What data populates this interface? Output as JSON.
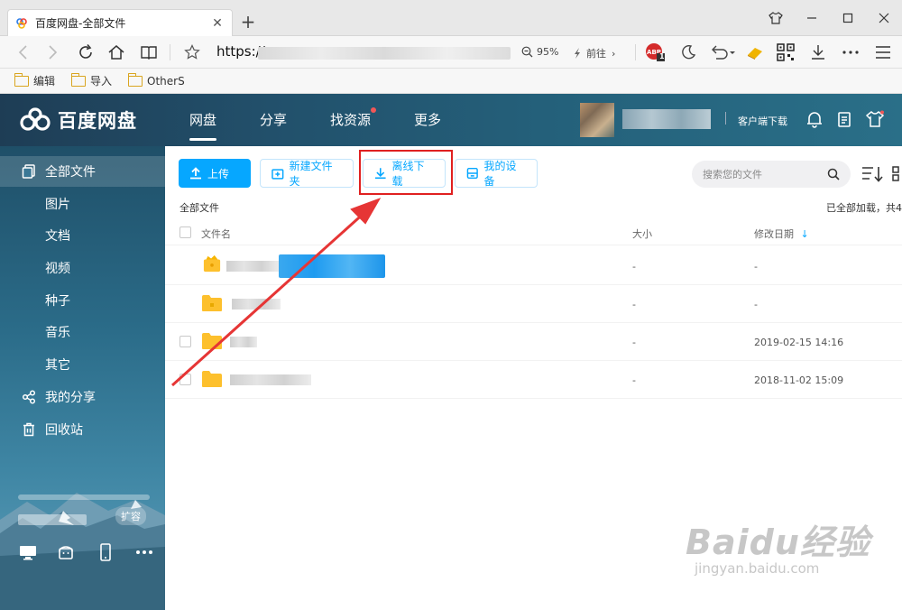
{
  "browser": {
    "tab_title": "百度网盘-全部文件",
    "tab_close": "✕",
    "new_tab": "+",
    "url_prefix": "https://",
    "zoom_level": "95%",
    "goto_label": "前往",
    "adblock_count": "1",
    "bookmarks": [
      "编辑",
      "导入",
      "OtherS"
    ]
  },
  "app": {
    "logo_text": "百度网盘",
    "top_nav": [
      {
        "label": "网盘",
        "active": true
      },
      {
        "label": "分享",
        "active": false
      },
      {
        "label": "找资源",
        "active": false,
        "badge": true
      },
      {
        "label": "更多",
        "active": false
      }
    ],
    "client_download": "客户端下载"
  },
  "sidebar": {
    "items": [
      {
        "label": "全部文件",
        "icon": "files-icon",
        "active": true
      },
      {
        "label": "图片"
      },
      {
        "label": "文档"
      },
      {
        "label": "视频"
      },
      {
        "label": "种子"
      },
      {
        "label": "音乐"
      },
      {
        "label": "其它"
      },
      {
        "label": "我的分享",
        "icon": "share-icon"
      },
      {
        "label": "回收站",
        "icon": "trash-icon"
      }
    ],
    "expand_label": "扩容"
  },
  "toolbar": {
    "upload": "上传",
    "new_folder": "新建文件夹",
    "offline_download": "离线下载",
    "my_devices": "我的设备",
    "search_placeholder": "搜索您的文件"
  },
  "files": {
    "breadcrumb": "全部文件",
    "loaded_status": "已全部加载，共4",
    "columns": {
      "name": "文件名",
      "size": "大小",
      "modified": "修改日期"
    },
    "rows": [
      {
        "size": "-",
        "modified": "-"
      },
      {
        "size": "-",
        "modified": "-"
      },
      {
        "size": "-",
        "modified": "2019-02-15 14:16"
      },
      {
        "size": "-",
        "modified": "2018-11-02 15:09"
      }
    ]
  },
  "watermark": {
    "main": "Baidu经验",
    "sub": "jingyan.baidu.com"
  },
  "colors": {
    "accent": "#06a7ff",
    "header": "#22506b",
    "highlight": "#e02020",
    "folder": "#fdc02d"
  }
}
